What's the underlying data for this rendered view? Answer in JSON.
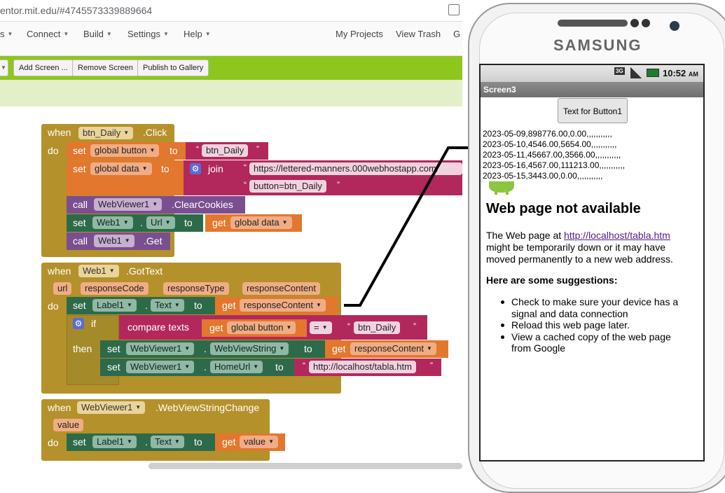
{
  "browser": {
    "url": "entor.mit.edu/#4745573339889664"
  },
  "menu": {
    "items": [
      "s",
      "Connect",
      "Build",
      "Settings",
      "Help"
    ],
    "right": [
      "My Projects",
      "View Trash",
      "G"
    ]
  },
  "toolbar": {
    "buttons": [
      "Add Screen ...",
      "Remove Screen",
      "Publish to Gallery"
    ]
  },
  "blocks": {
    "b1": {
      "when": "when",
      "component": "btn_Daily",
      "event": ".Click",
      "do": "do",
      "set1": {
        "set": "set",
        "var": "global button",
        "to": "to",
        "str": "btn_Daily"
      },
      "set2": {
        "set": "set",
        "var": "global data",
        "to": "to",
        "join": "join",
        "str1": "https://lettered-manners.000webhostapp.com/",
        "str2": "button=btn_Daily"
      },
      "call1": {
        "call": "call",
        "comp": "WebViewer1",
        "method": ".ClearCookies"
      },
      "set3": {
        "set": "set",
        "comp": "Web1",
        "prop": "Url",
        "to": "to",
        "get": "get",
        "var": "global data"
      },
      "call2": {
        "call": "call",
        "comp": "Web1",
        "method": ".Get"
      }
    },
    "b2": {
      "when": "when",
      "component": "Web1",
      "event": ".GotText",
      "params": [
        "url",
        "responseCode",
        "responseType",
        "responseContent"
      ],
      "do": "do",
      "set1": {
        "set": "set",
        "comp": "Label1",
        "prop": "Text",
        "to": "to",
        "get": "get",
        "var": "responseContent"
      },
      "if": "if",
      "compare": "compare texts",
      "get": "get",
      "var": "global button",
      "op": "=",
      "str": "btn_Daily",
      "then": "then",
      "set2": {
        "set": "set",
        "comp": "WebViewer1",
        "prop": "WebViewString",
        "to": "to",
        "get": "get",
        "var": "responseContent"
      },
      "set3": {
        "set": "set",
        "comp": "WebViewer1",
        "prop": "HomeUrl",
        "to": "to",
        "str": "http://localhost/tabla.htm"
      }
    },
    "b3": {
      "when": "when",
      "component": "WebViewer1",
      "event": ".WebViewStringChange",
      "param": "value",
      "do": "do",
      "set1": {
        "set": "set",
        "comp": "Label1",
        "prop": "Text",
        "to": "to",
        "get": "get",
        "var": "value"
      }
    }
  },
  "phone": {
    "brand": "SAMSUNG",
    "status": {
      "network": "3G",
      "time": "10:52",
      "ampm": "AM"
    },
    "screen_title": "Screen3",
    "button": "Text for Button1",
    "csv": [
      "2023-05-09,898776.00,0.00,,,,,,,,,,,",
      "2023-05-10,4546.00,5654.00,,,,,,,,,,,",
      "2023-05-11,45667.00,3566.00,,,,,,,,,,,",
      "2023-05-16,4567.00,111213.00,,,,,,,,,,,",
      "2023-05-15,3443.00,0.00,,,,,,,,,,,"
    ],
    "error": {
      "title": "Web page not available",
      "p1_before": "The Web page at ",
      "link": "http://localhost/tabla.htm",
      "p1_after": " might be temporarily down or it may have moved permanently to a new web address.",
      "suggestions_title": "Here are some suggestions:",
      "suggestions": [
        "Check to make sure your device has a signal and data connection",
        "Reload this web page later.",
        "View a cached copy of the web page from Google"
      ]
    }
  },
  "colors": {
    "toolbar": "#8ec61d",
    "event": "#b4912b",
    "set": "#e3772d",
    "text": "#b3285c",
    "component": "#2d6a4a",
    "call": "#7a4f8f"
  }
}
